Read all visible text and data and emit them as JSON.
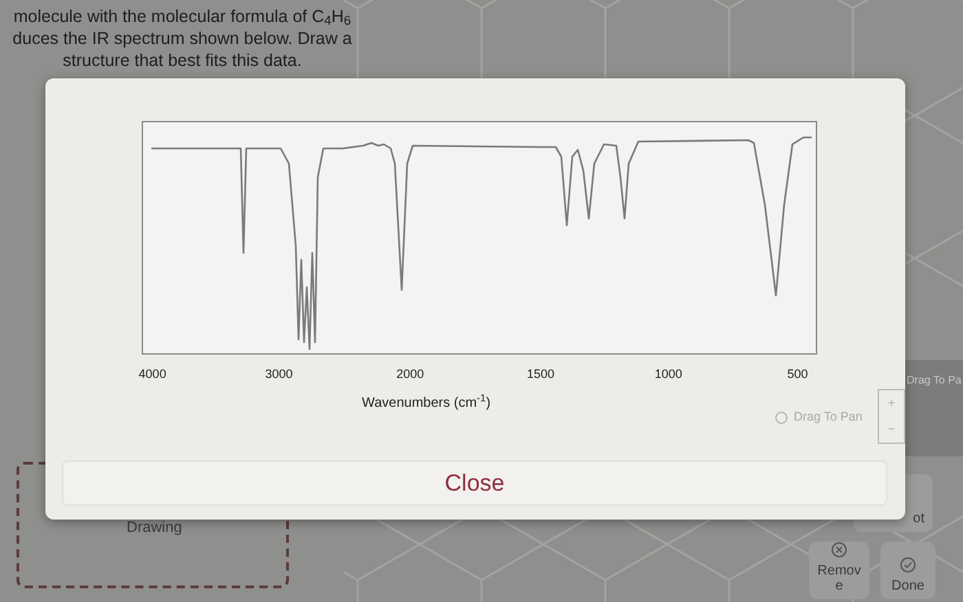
{
  "question": {
    "lines": [
      "molecule with the molecular formula of C$_{4}$H$_{6}$",
      "duces the IR spectrum shown below. Draw a",
      "structure that best fits this data."
    ]
  },
  "background": {
    "drag_hint": "Drag To Pa",
    "drawing_label": "Drawing",
    "buttons": [
      {
        "label": "ot",
        "kind": "plain"
      },
      {
        "label": "Remove",
        "kind": "remove"
      },
      {
        "label": "Done",
        "kind": "done"
      }
    ]
  },
  "spectrum_modal": {
    "x_tick_labels": [
      "4000",
      "3000",
      "2000",
      "1500",
      "1000",
      "500"
    ],
    "x_axis_label": "Wavenumbers (cm$^{-1}$)",
    "pan_hint": "Drag To Pan",
    "zoom_in": "+",
    "zoom_out": "−",
    "close_button": "Close"
  }
}
